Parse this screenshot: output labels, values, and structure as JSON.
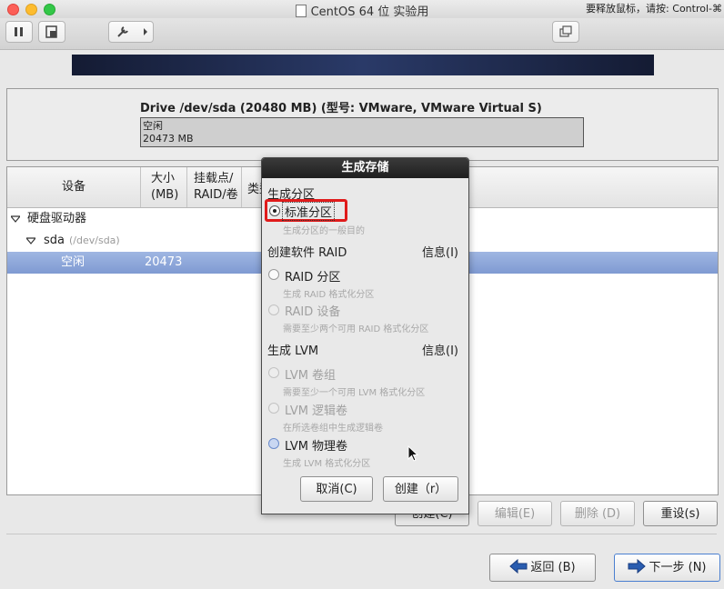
{
  "window": {
    "title": "CentOS 64 位 实验用",
    "hint": "要释放鼠标，请按: Control-⌘"
  },
  "drive": {
    "title": "Drive /dev/sda (20480 MB) (型号: VMware, VMware Virtual S)",
    "bar_label": "空闲",
    "bar_size": "20473 MB"
  },
  "table": {
    "headers": {
      "device": "设备",
      "size_line1": "大小",
      "size_line2": "(MB)",
      "mount_line1": "挂载点/",
      "mount_line2": "RAID/卷",
      "type": "类型"
    },
    "tree": {
      "group": "硬盘驱动器",
      "disk": "sda",
      "disk_path": "(/dev/sda)",
      "free_label": "空闲",
      "free_size": "20473"
    }
  },
  "actions": {
    "create": "创建(C)",
    "edit": "编辑(E)",
    "delete": "删除 (D)",
    "reset": "重设(s)"
  },
  "nav": {
    "back": "返回 (B)",
    "next": "下一步 (N)"
  },
  "dialog": {
    "title": "生成存储",
    "section_partition": "生成分区",
    "standard_partition": "标准分区",
    "standard_partition_desc": "生成分区的一般目的",
    "section_raid": "创建软件 RAID",
    "info1": "信息(I)",
    "raid_partition": "RAID 分区",
    "raid_partition_desc": "生成 RAID 格式化分区",
    "raid_device": "RAID 设备",
    "raid_device_desc": "需要至少两个可用 RAID 格式化分区",
    "section_lvm": "生成 LVM",
    "info2": "信息(I)",
    "lvm_vg": "LVM 卷组",
    "lvm_vg_desc": "需要至少一个可用 LVM 格式化分区",
    "lvm_lv": "LVM 逻辑卷",
    "lvm_lv_desc": "在所选卷组中生成逻辑卷",
    "lvm_pv": "LVM 物理卷",
    "lvm_pv_desc": "生成 LVM 格式化分区",
    "cancel": "取消(C)",
    "create": "创建（r）"
  },
  "colors": {
    "selection": "#8aa3d8",
    "highlight_box": "#e01b1b",
    "banner": "#1c2545"
  }
}
